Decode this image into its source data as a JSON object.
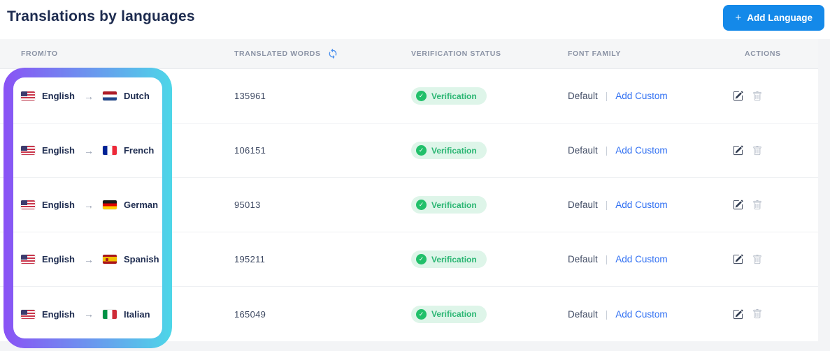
{
  "page": {
    "title": "Translations by languages",
    "add_language_label": "Add Language"
  },
  "icons": {
    "plus_icon": "+",
    "arrow_right_icon": "→",
    "check_icon": "✓",
    "refresh_icon": "sync-arrows",
    "edit_icon": "pencil-square",
    "delete_icon": "trash-can"
  },
  "table": {
    "columns": {
      "from_to": "FROM/TO",
      "translated_words": "TRANSLATED WORDS",
      "verification_status": "VERIFICATION STATUS",
      "font_family": "FONT FAMILY",
      "actions": "ACTIONS"
    },
    "separator": "|",
    "rows": [
      {
        "from": "English",
        "from_flag": "us",
        "to": "Dutch",
        "to_flag": "nl",
        "translated_words": "135961",
        "verification_status": "Verification",
        "font_default": "Default",
        "font_custom_link": "Add Custom"
      },
      {
        "from": "English",
        "from_flag": "us",
        "to": "French",
        "to_flag": "fr",
        "translated_words": "106151",
        "verification_status": "Verification",
        "font_default": "Default",
        "font_custom_link": "Add Custom"
      },
      {
        "from": "English",
        "from_flag": "us",
        "to": "German",
        "to_flag": "de",
        "translated_words": "95013",
        "verification_status": "Verification",
        "font_default": "Default",
        "font_custom_link": "Add Custom"
      },
      {
        "from": "English",
        "from_flag": "us",
        "to": "Spanish",
        "to_flag": "es",
        "translated_words": "195211",
        "verification_status": "Verification",
        "font_default": "Default",
        "font_custom_link": "Add Custom"
      },
      {
        "from": "English",
        "from_flag": "us",
        "to": "Italian",
        "to_flag": "it",
        "translated_words": "165049",
        "verification_status": "Verification",
        "font_default": "Default",
        "font_custom_link": "Add Custom"
      }
    ]
  },
  "colors": {
    "title_text": "#1d2b4f",
    "accent_blue": "#1489e9",
    "link_blue": "#2f6ff2",
    "refresh_blue": "#4a90ee",
    "badge_bg": "#def5e9",
    "badge_text": "#2bb673",
    "badge_check_bg": "#21c06a",
    "highlight_gradient_start": "#8a52f5",
    "highlight_gradient_end": "#4dd6e8",
    "header_text": "#8b93a5",
    "body_text": "#3f4a63"
  }
}
